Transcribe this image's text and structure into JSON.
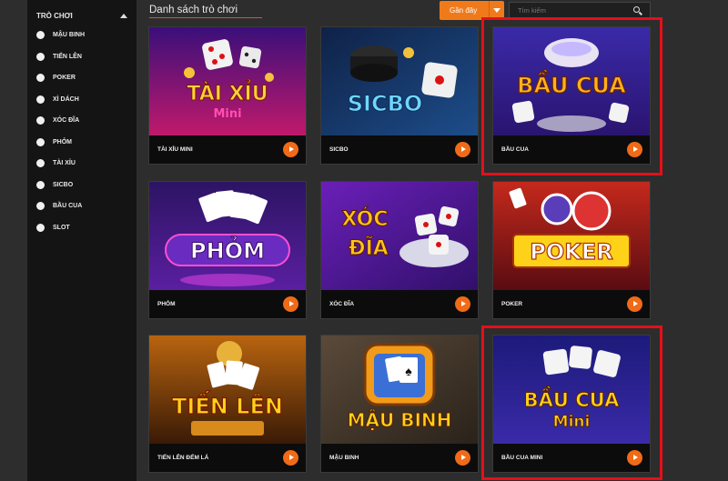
{
  "sidebar": {
    "title": "TRÒ CHƠI",
    "items": [
      {
        "label": "MẬU BINH"
      },
      {
        "label": "TIẾN LÊN"
      },
      {
        "label": "POKER"
      },
      {
        "label": "XÌ DÁCH"
      },
      {
        "label": "XÓC ĐĨA"
      },
      {
        "label": "PHỎM"
      },
      {
        "label": "TÀI XỈU"
      },
      {
        "label": "SICBO"
      },
      {
        "label": "BẦU CUA"
      },
      {
        "label": "SLOT"
      }
    ]
  },
  "header": {
    "title": "Danh sách trò chơi",
    "sort_label": "Gần đây",
    "search_placeholder": "Tìm kiếm"
  },
  "games": [
    {
      "label": "TÀI XỈU MINI",
      "art_line1": "TÀI XỈU",
      "art_line2": "Mini"
    },
    {
      "label": "SICBO",
      "art_line1": "SICBO"
    },
    {
      "label": "BẦU CUA",
      "art_line1": "BẦU CUA"
    },
    {
      "label": "PHỎM",
      "art_line1": "PHỎM"
    },
    {
      "label": "XÓC ĐĨA",
      "art_line1": "XÓC",
      "art_line2": "ĐĨA"
    },
    {
      "label": "POKER",
      "art_line1": "POKER"
    },
    {
      "label": "TIẾN LÊN ĐẾM LÁ",
      "art_line1": "TIẾN LÊN"
    },
    {
      "label": "MẬU BINH",
      "art_line1": "MẬU BINH"
    },
    {
      "label": "BẦU CUA MINI",
      "art_line1": "BẦU CUA",
      "art_line2": "Mini"
    }
  ],
  "colors": {
    "accent": "#f07a1a",
    "highlight": "#e3101b",
    "sidebar_bg": "#141414",
    "page_bg": "#2d2d2d"
  }
}
